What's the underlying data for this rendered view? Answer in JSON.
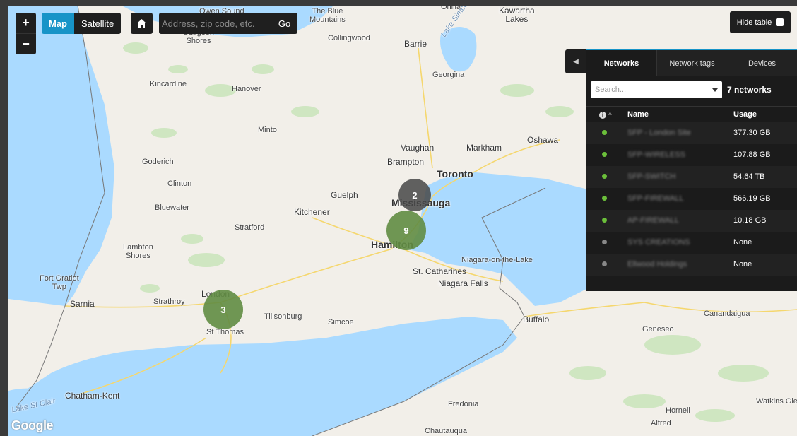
{
  "controls": {
    "zoom_in": "+",
    "zoom_out": "−",
    "map_type": {
      "map": "Map",
      "satellite": "Satellite",
      "selected": "Map"
    },
    "home_icon": "home-icon",
    "address": {
      "placeholder": "Address, zip code, etc.",
      "value": "",
      "go": "Go"
    },
    "hide_table": "Hide table"
  },
  "clusters": [
    {
      "count": "2",
      "color": "#464646"
    },
    {
      "count": "9",
      "color": "#608c42"
    },
    {
      "count": "3",
      "color": "#608c42"
    }
  ],
  "places": {
    "the_blue_mountains": "The Blue\nMountains",
    "owen_sound": "Owen Sound",
    "orillia": "Orillia",
    "kawartha_lakes": "Kawartha\nLakes",
    "collingwood": "Collingwood",
    "saugeen_shores": "Saugeen\nShores",
    "barrie": "Barrie",
    "lake_simcoe": "Lake Simcoe",
    "georgina": "Georgina",
    "kincardine": "Kincardine",
    "hanover": "Hanover",
    "minto": "Minto",
    "oshawa": "Oshawa",
    "vaughan": "Vaughan",
    "markham": "Markham",
    "goderich": "Goderich",
    "brampton": "Brampton",
    "toronto": "Toronto",
    "clinton": "Clinton",
    "guelph": "Guelph",
    "mississauga": "Mississauga",
    "bluewater": "Bluewater",
    "kitchener": "Kitchener",
    "stratford": "Stratford",
    "hamilton": "Hamilton",
    "lambton_shores": "Lambton\nShores",
    "niagara_on_the_lake": "Niagara-on-the-Lake",
    "st_catharines": "St. Catharines",
    "niagara_falls": "Niagara Falls",
    "fort_gratiot": "Fort Gratiot\nTwp",
    "sarnia": "Sarnia",
    "strathroy": "Strathroy",
    "london": "London",
    "tillsonburg": "Tillsonburg",
    "simcoe": "Simcoe",
    "buffalo": "Buffalo",
    "canandaigua": "Canandaigua",
    "geneseo": "Geneseo",
    "st_thomas": "St Thomas",
    "chatham_kent": "Chatham-Kent",
    "lake_st_clair": "Lake St Clair",
    "fredonia": "Fredonia",
    "hornell": "Hornell",
    "watkins_glen": "Watkins Gle",
    "alfred": "Alfred",
    "chautauqua": "Chautauqua",
    "google": "Google"
  },
  "panel": {
    "tabs": [
      "Networks",
      "Network tags",
      "Devices"
    ],
    "active_tab": "Networks",
    "search_placeholder": "Search...",
    "count_label": "7 networks",
    "columns": {
      "info_icon": "info-icon",
      "name": "Name",
      "usage": "Usage"
    },
    "rows": [
      {
        "status": "online",
        "status_color": "#6bbf3a",
        "name": "SFP - London Site",
        "usage": "377.30 GB"
      },
      {
        "status": "online",
        "status_color": "#6bbf3a",
        "name": "SFP-WIRELESS",
        "usage": "107.88 GB"
      },
      {
        "status": "online",
        "status_color": "#6bbf3a",
        "name": "SFP-SWITCH",
        "usage": "54.64 TB"
      },
      {
        "status": "online",
        "status_color": "#6bbf3a",
        "name": "SFP-FIREWALL",
        "usage": "566.19 GB"
      },
      {
        "status": "online",
        "status_color": "#6bbf3a",
        "name": "AP-FIREWALL",
        "usage": "10.18 GB"
      },
      {
        "status": "offline",
        "status_color": "#888888",
        "name": "SYS CREATIONS",
        "usage": "None"
      },
      {
        "status": "offline",
        "status_color": "#888888",
        "name": "Ellwood Holdings",
        "usage": "None"
      }
    ]
  },
  "colors": {
    "accent": "#1794c8",
    "water": "#aadaff",
    "land": "#f2efe9",
    "panel_bg": "#1b1b1b"
  }
}
